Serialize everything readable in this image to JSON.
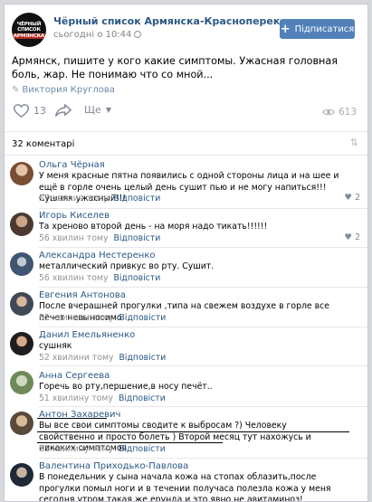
{
  "post": {
    "group_name": "Чёрный список Армянска-Красноперекопска",
    "time": "сьогодні о 10:44",
    "avatar_lines": [
      "ЧЁРНЫЙ",
      "СПИСОК",
      "АРМЯНСКА"
    ],
    "subscribe_label": "Підписатися",
    "text": "Армянск, пишите у кого какие симптомы. Ужасная головная боль, жар. Не понимаю что со мной...",
    "author": "Виктория Круглова",
    "likes": "13",
    "share_label": "Ще",
    "views": "613"
  },
  "comments_header": {
    "count_label": "32 коментарі"
  },
  "comments": [
    {
      "name": "Ольга Чёрная",
      "text": "У меня красные пятна появились с одной стороны лица и на шее и ещё в горле очень целый день сушит пью и не могу напиться!!! Сушняк ужасный!!!",
      "time": "57 хвилин тому",
      "reply": "Відповісти",
      "likes": "2",
      "avatar_color": "#b88a6c"
    },
    {
      "name": "Игорь Киселев",
      "text": "Та хреново второй день - на моря надо тикать!!!!!!",
      "time": "56 хвилин тому",
      "reply": "Відповісти",
      "likes": "2",
      "avatar_color": "#6b5a4c"
    },
    {
      "name": "Александра Нестеренко",
      "text": "металлический привкус во рту. Сушит.",
      "time": "56 хвилин тому",
      "reply": "Відповісти",
      "likes": "",
      "avatar_color": "#5a6f86"
    },
    {
      "name": "Евгения Антонова",
      "text": "После вчерашней прогулки ,типа на свежем воздухе в горле все печет невыносимо",
      "time": "52 хвилини тому",
      "reply": "Відповісти",
      "likes": "",
      "avatar_color": "#4d5a68"
    },
    {
      "name": "Данил Емельяненко",
      "text": "сушняк",
      "time": "52 хвилини тому",
      "reply": "Відповісти",
      "likes": "",
      "avatar_color": "#3b3b3b"
    },
    {
      "name": "Анна Сергеева",
      "text": "Горечь во рту,першение,в носу печёт..",
      "time": "51 хвилину тому",
      "reply": "Відповісти",
      "likes": "",
      "avatar_color": "#8fa07a"
    },
    {
      "name": "Антон Захаревич",
      "text": "Вы все свои симптомы сводите к выбросам ?) Человеку свойственно и просто болеть ) Второй месяц тут нахожусь и никаких симптомов",
      "time": "51 хвилину тому",
      "reply": "Відповісти",
      "likes": "",
      "avatar_color": "#a08a6a"
    },
    {
      "name": "Валентина Приходько-Павлова",
      "text": "В понедельник у сына начала кожа на стопах облазить,после прогулки помыл ноги и в течении получаса полезла кожа у меня сегодня утром такая же ерунда и это явно не авитаминоз!",
      "time": "",
      "reply": "",
      "likes": "",
      "avatar_color": "#2f3a4a"
    }
  ]
}
